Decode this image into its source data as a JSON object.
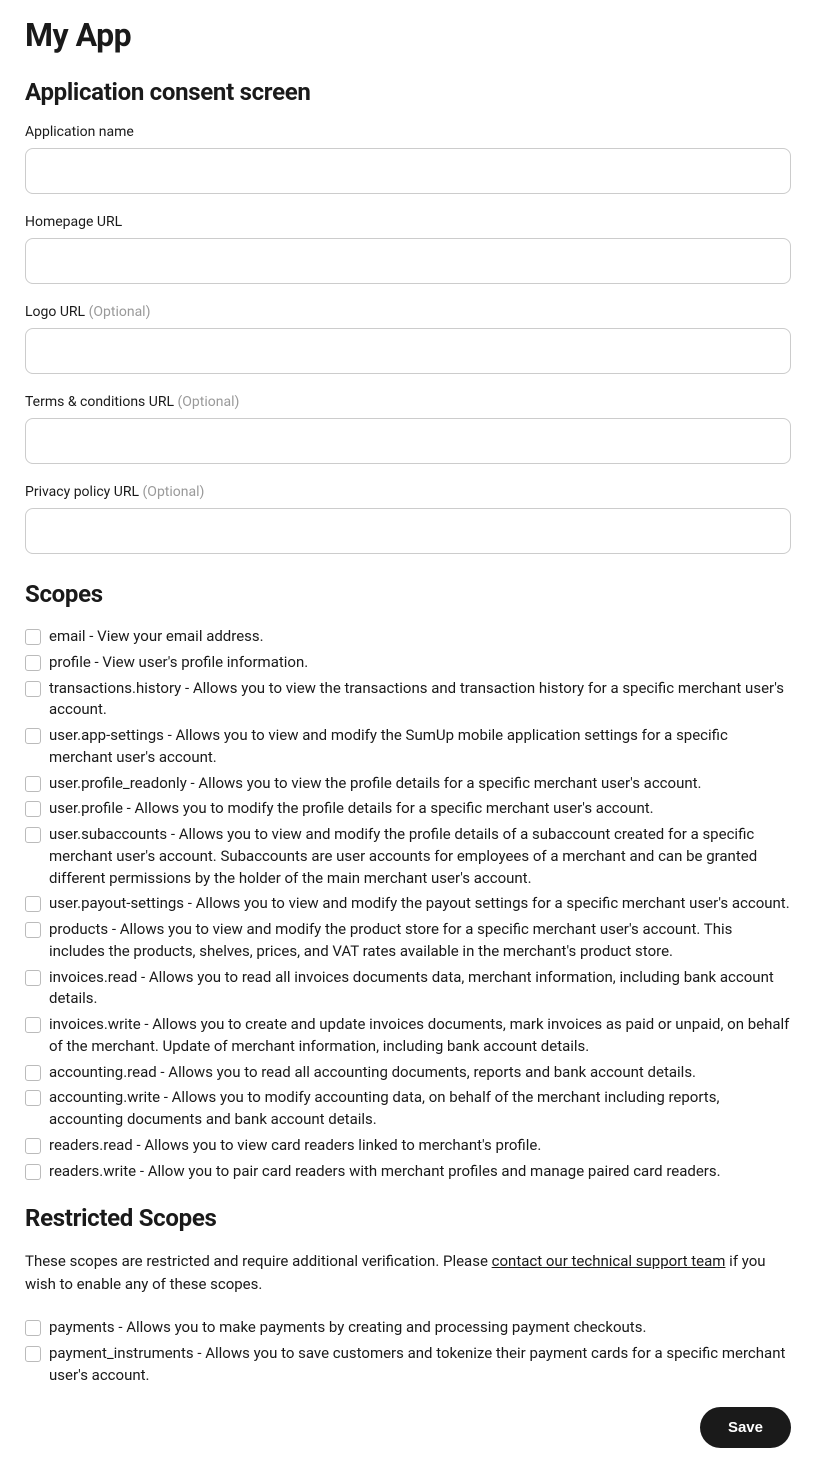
{
  "page_title": "My App",
  "section_consent": {
    "heading": "Application consent screen",
    "fields": {
      "app_name": {
        "label": "Application name",
        "optional": false,
        "value": ""
      },
      "homepage_url": {
        "label": "Homepage URL",
        "optional": false,
        "value": ""
      },
      "logo_url": {
        "label": "Logo URL",
        "optional": true,
        "optional_text": "(Optional)",
        "value": ""
      },
      "terms_url": {
        "label": "Terms & conditions URL",
        "optional": true,
        "optional_text": "(Optional)",
        "value": ""
      },
      "privacy_url": {
        "label": "Privacy policy URL",
        "optional": true,
        "optional_text": "(Optional)",
        "value": ""
      }
    }
  },
  "section_scopes": {
    "heading": "Scopes",
    "items": [
      {
        "text": "email - View your email address."
      },
      {
        "text": "profile - View user's profile information."
      },
      {
        "text": "transactions.history - Allows you to view the transactions and transaction history for a specific merchant user's account."
      },
      {
        "text": "user.app-settings - Allows you to view and modify the SumUp mobile application settings for a specific merchant user's account."
      },
      {
        "text": "user.profile_readonly - Allows you to view the profile details for a specific merchant user's account."
      },
      {
        "text": "user.profile - Allows you to modify the profile details for a specific merchant user's account."
      },
      {
        "text": "user.subaccounts - Allows you to view and modify the profile details of a subaccount created for a specific merchant user's account. Subaccounts are user accounts for employees of a merchant and can be granted different permissions by the holder of the main merchant user's account."
      },
      {
        "text": "user.payout-settings - Allows you to view and modify the payout settings for a specific merchant user's account."
      },
      {
        "text": "products - Allows you to view and modify the product store for a specific merchant user's account. This includes the products, shelves, prices, and VAT rates available in the merchant's product store."
      },
      {
        "text": "invoices.read - Allows you to read all invoices documents data, merchant information, including bank account details."
      },
      {
        "text": "invoices.write - Allows you to create and update invoices documents, mark invoices as paid or unpaid, on behalf of the merchant. Update of merchant information, including bank account details."
      },
      {
        "text": "accounting.read - Allows you to read all accounting documents, reports and bank account details."
      },
      {
        "text": "accounting.write - Allows you to modify accounting data, on behalf of the merchant including reports, accounting documents and bank account details."
      },
      {
        "text": "readers.read - Allows you to view card readers linked to merchant's profile."
      },
      {
        "text": "readers.write - Allow you to pair card readers with merchant profiles and manage paired card readers."
      }
    ]
  },
  "section_restricted": {
    "heading": "Restricted Scopes",
    "desc_before": "These scopes are restricted and require additional verification. Please ",
    "link_text": "contact our technical support team",
    "desc_after": " if you wish to enable any of these scopes.",
    "items": [
      {
        "text": "payments - Allows you to make payments by creating and processing payment checkouts."
      },
      {
        "text": "payment_instruments - Allows you to save customers and tokenize their payment cards for a specific merchant user's account."
      }
    ]
  },
  "buttons": {
    "save": "Save"
  }
}
